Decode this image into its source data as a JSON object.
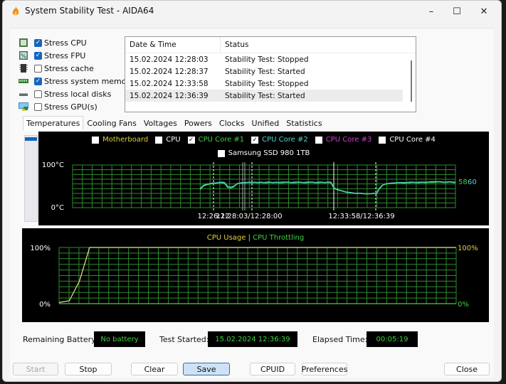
{
  "window": {
    "title": "System Stability Test - AIDA64",
    "controls": {
      "minimize": "–",
      "maximize": "☐",
      "close": "✕"
    }
  },
  "stress_options": [
    {
      "label": "Stress CPU",
      "checked": true,
      "icon": "cpu-icon"
    },
    {
      "label": "Stress FPU",
      "checked": true,
      "icon": "fpu-icon"
    },
    {
      "label": "Stress cache",
      "checked": false,
      "icon": "cache-icon"
    },
    {
      "label": "Stress system memory",
      "checked": true,
      "icon": "memory-icon"
    },
    {
      "label": "Stress local disks",
      "checked": false,
      "icon": "disk-icon"
    },
    {
      "label": "Stress GPU(s)",
      "checked": false,
      "icon": "gpu-icon"
    }
  ],
  "log": {
    "columns": [
      "Date & Time",
      "Status"
    ],
    "rows": [
      {
        "datetime": "15.02.2024 12:28:03",
        "status": "Stability Test: Stopped"
      },
      {
        "datetime": "15.02.2024 12:28:37",
        "status": "Stability Test: Started"
      },
      {
        "datetime": "15.02.2024 12:33:58",
        "status": "Stability Test: Stopped"
      },
      {
        "datetime": "15.02.2024 12:36:39",
        "status": "Stability Test: Started"
      }
    ],
    "selected_row": 3
  },
  "tabs": [
    "Temperatures",
    "Cooling Fans",
    "Voltages",
    "Powers",
    "Clocks",
    "Unified",
    "Statistics"
  ],
  "active_tab": "Temperatures",
  "temperature_legend": [
    {
      "label": "Motherboard",
      "checked": false,
      "color": "#e0d040"
    },
    {
      "label": "CPU",
      "checked": false,
      "color": "#ffffff"
    },
    {
      "label": "CPU Core #1",
      "checked": true,
      "color": "#3fd13f"
    },
    {
      "label": "CPU Core #2",
      "checked": true,
      "color": "#4fd4d4"
    },
    {
      "label": "CPU Core #3",
      "checked": false,
      "color": "#d040d0"
    },
    {
      "label": "CPU Core #4",
      "checked": false,
      "color": "#ffffff"
    },
    {
      "label": "Samsung SSD 980 1TB",
      "checked": false,
      "color": "#ffffff"
    }
  ],
  "chart_data": [
    {
      "type": "line",
      "title": "Temperatures",
      "ylabel_top": "100°C",
      "ylabel_bottom": "0°C",
      "ylim": [
        0,
        100
      ],
      "grid": true,
      "markers": [
        "12:26:12",
        "12:28:03",
        "12:28:00",
        "12:33:58",
        "12:36:39"
      ],
      "marker_labels": [
        "12:26:12",
        "12:28:03/12:28:00",
        "12:33:58/12:36:39"
      ],
      "series": [
        {
          "name": "CPU Core #1",
          "color": "#3fd13f",
          "current": 58,
          "values": [
            null,
            null,
            null,
            null,
            null,
            null,
            null,
            null,
            null,
            null,
            null,
            null,
            null,
            null,
            null,
            null,
            null,
            null,
            null,
            null,
            null,
            null,
            null,
            null,
            null,
            null,
            null,
            null,
            null,
            null,
            null,
            null,
            null,
            null,
            null,
            null,
            null,
            null,
            null,
            null,
            null,
            null,
            42,
            50,
            53,
            55,
            56,
            57,
            58,
            58,
            57,
            47,
            46,
            48,
            55,
            57,
            58,
            58,
            59,
            58,
            59,
            58,
            59,
            58,
            58,
            59,
            58,
            59,
            58,
            58,
            59,
            59,
            58,
            58,
            59,
            59,
            58,
            58,
            59,
            59,
            58,
            58,
            59,
            58,
            59,
            58,
            45,
            42,
            40,
            38,
            36,
            35,
            34,
            33,
            33,
            33,
            32,
            32,
            32,
            33,
            32,
            44,
            52,
            55,
            56,
            57,
            57,
            58,
            58,
            57,
            58,
            58,
            59,
            58,
            58,
            59,
            58,
            59,
            59,
            59,
            60,
            60,
            59,
            59,
            60,
            59,
            58
          ]
        },
        {
          "name": "CPU Core #2",
          "color": "#4fd4d4",
          "current": 60,
          "values": [
            null,
            null,
            null,
            null,
            null,
            null,
            null,
            null,
            null,
            null,
            null,
            null,
            null,
            null,
            null,
            null,
            null,
            null,
            null,
            null,
            null,
            null,
            null,
            null,
            null,
            null,
            null,
            null,
            null,
            null,
            null,
            null,
            null,
            null,
            null,
            null,
            null,
            null,
            null,
            null,
            null,
            null,
            45,
            52,
            55,
            56,
            58,
            58,
            59,
            60,
            59,
            50,
            48,
            50,
            56,
            58,
            59,
            59,
            60,
            59,
            60,
            59,
            60,
            59,
            60,
            60,
            59,
            60,
            59,
            60,
            60,
            60,
            59,
            60,
            60,
            60,
            59,
            60,
            60,
            60,
            59,
            60,
            60,
            59,
            60,
            60,
            47,
            43,
            41,
            39,
            37,
            36,
            35,
            34,
            34,
            34,
            33,
            33,
            33,
            34,
            33,
            46,
            53,
            56,
            57,
            58,
            58,
            59,
            59,
            59,
            59,
            60,
            60,
            59,
            60,
            60,
            60,
            60,
            61,
            61,
            61,
            61,
            60,
            60,
            61,
            60,
            60
          ]
        }
      ]
    },
    {
      "type": "line",
      "title": "CPU Usage | CPU Throttling",
      "series_titles": [
        {
          "name": "CPU Usage",
          "color": "#e0d040"
        },
        {
          "name": "CPU Throttling",
          "color": "#3fd13f"
        }
      ],
      "ylabel_top": "100%",
      "ylabel_bottom": "0%",
      "ylim": [
        0,
        100
      ],
      "grid": true,
      "series": [
        {
          "name": "CPU Usage",
          "color": "#e8e88a",
          "values": [
            2,
            5,
            40,
            100,
            100,
            100,
            100,
            100,
            100,
            100,
            100,
            100,
            100,
            100,
            100,
            100,
            100,
            100,
            100,
            100,
            100,
            100,
            100,
            100,
            100,
            100,
            100,
            100,
            100,
            100,
            100,
            100,
            100,
            100,
            100,
            100,
            100,
            100,
            100,
            100
          ]
        },
        {
          "name": "CPU Throttling",
          "color": "#3fd13f",
          "values": [
            0,
            0,
            0,
            0,
            0,
            0,
            0,
            0,
            0,
            0,
            0,
            0,
            0,
            0,
            0,
            0,
            0,
            0,
            0,
            0,
            0,
            0,
            0,
            0,
            0,
            0,
            0,
            0,
            0,
            0,
            0,
            0,
            0,
            0,
            0,
            0,
            0,
            0,
            0,
            0
          ]
        }
      ]
    }
  ],
  "status": {
    "battery_label": "Remaining Battery:",
    "battery_value": "No battery",
    "started_label": "Test Started:",
    "started_value": "15.02.2024 12:36:39",
    "elapsed_label": "Elapsed Time:",
    "elapsed_value": "00:05:19"
  },
  "buttons": {
    "start": "Start",
    "stop": "Stop",
    "clear": "Clear",
    "save": "Save",
    "cpuid": "CPUID",
    "preferences": "Preferences",
    "close": "Close"
  }
}
